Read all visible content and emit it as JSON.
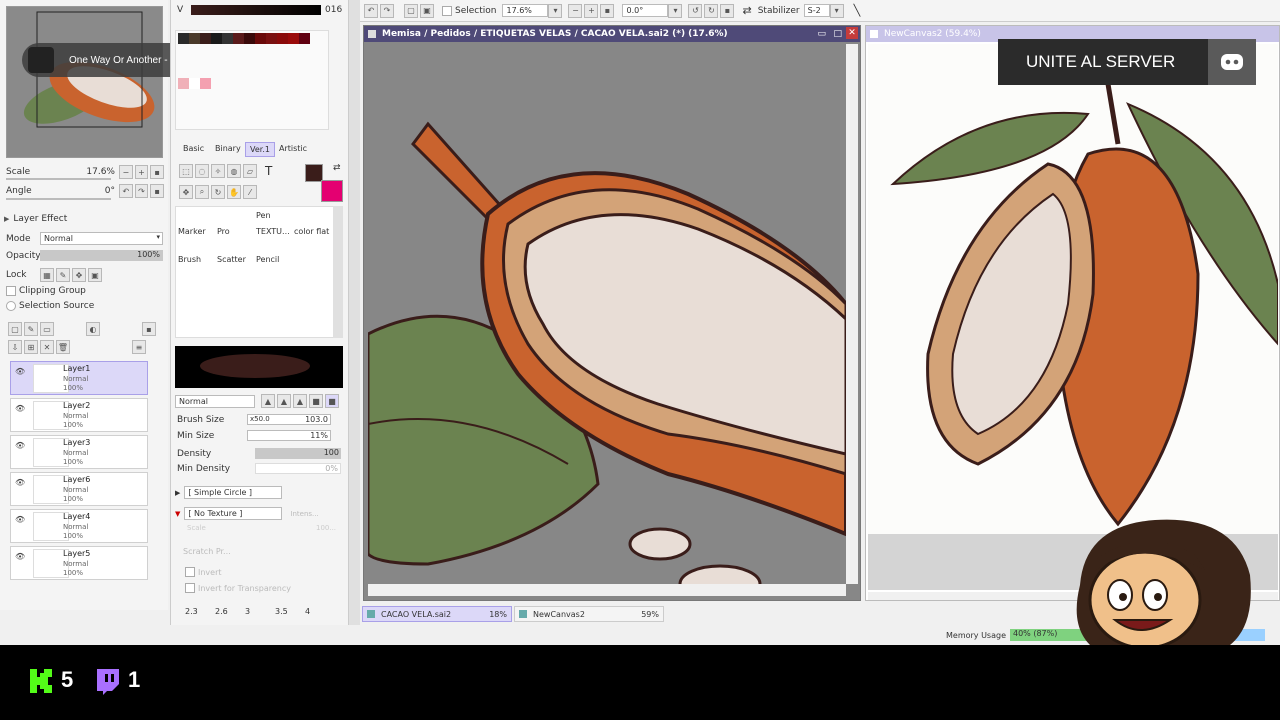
{
  "navigator": {
    "scale_label": "Scale",
    "scale_value": "17.6%",
    "angle_label": "Angle",
    "angle_value": "0°"
  },
  "media_overlay": {
    "track": "One Way Or Another - ..."
  },
  "color_panel": {
    "v_label": "V",
    "v_value": "016"
  },
  "layer_effect": {
    "label": "Layer Effect"
  },
  "layer_props": {
    "mode_label": "Mode",
    "mode_value": "Normal",
    "opacity_label": "Opacity",
    "opacity_value": "100%",
    "lock_label": "Lock",
    "clipping_label": "Clipping Group",
    "selection_label": "Selection Source"
  },
  "layers": [
    {
      "name": "Layer1",
      "mode": "Normal",
      "opacity": "100%"
    },
    {
      "name": "Layer2",
      "mode": "Normal",
      "opacity": "100%"
    },
    {
      "name": "Layer3",
      "mode": "Normal",
      "opacity": "100%"
    },
    {
      "name": "Layer6",
      "mode": "Normal",
      "opacity": "100%"
    },
    {
      "name": "Layer4",
      "mode": "Normal",
      "opacity": "100%"
    },
    {
      "name": "Layer5",
      "mode": "Normal",
      "opacity": "100%"
    }
  ],
  "tool_tabs": [
    "Basic",
    "Binary",
    "Ver.1",
    "Artistic"
  ],
  "brushes": [
    {
      "name": "Pen"
    },
    {
      "name": "Marker"
    },
    {
      "name": "Pro"
    },
    {
      "name": "TEXTU..."
    },
    {
      "name": "color flat"
    },
    {
      "name": "Brush"
    },
    {
      "name": "Scatter"
    },
    {
      "name": "Pencil"
    }
  ],
  "brush_settings": {
    "blend_mode": "Normal",
    "size_label": "Brush Size",
    "size_mult": "x50.0",
    "size_value": "103.0",
    "min_size_label": "Min Size",
    "min_size_value": "11%",
    "density_label": "Density",
    "density_value": "100",
    "min_density_label": "Min Density",
    "min_density_value": "0%",
    "shape": "[ Simple Circle ]",
    "texture": "[ No Texture ]",
    "intensity": "Intens...",
    "scale_label": "Scale",
    "scale_value": "100...",
    "scratch_label": "Scratch Pr...",
    "invert_label": "Invert",
    "invert_transparency_label": "Invert for Transparency",
    "size_presets": [
      "2.3",
      "2.6",
      "3",
      "3.5",
      "4"
    ]
  },
  "toolbar": {
    "selection_label": "Selection",
    "zoom_value": "17.6%",
    "rotation_value": "0.0°",
    "stabilizer_label": "Stabilizer",
    "stabilizer_value": "S-2"
  },
  "main_canvas": {
    "title": "Memisa / Pedidos / ETIQUETAS VELAS / CACAO VELA.sai2 (*) (17.6%)"
  },
  "second_canvas": {
    "title": "NewCanvas2 (59.4%)"
  },
  "doc_tabs": [
    {
      "name": "CACAO VELA.sai2",
      "zoom": "18%"
    },
    {
      "name": "NewCanvas2",
      "zoom": "59%"
    }
  ],
  "status": {
    "memory_label": "Memory Usage",
    "memory_value": "40% (87%)"
  },
  "stream_overlay": {
    "server_text": "UNITE AL SERVER",
    "kick_count": "5",
    "twitch_count": "1"
  },
  "colors": {
    "accent": "#e40071",
    "foreground": "#3a1d1a",
    "canvas_bg": "#878787",
    "pod_orange": "#c9632e",
    "pod_tan": "#d3a378",
    "bean_cream": "#e8ddd6",
    "leaf_green": "#6b8350"
  }
}
